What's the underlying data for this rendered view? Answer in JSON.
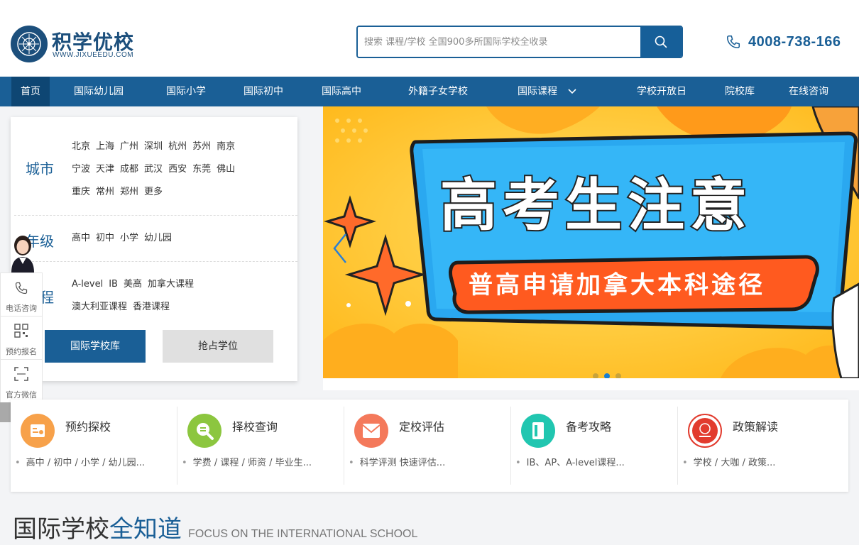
{
  "header": {
    "logo_name": "积学优校",
    "logo_url": "WWW.JIXUEEDU.COM",
    "search_placeholder": "搜索 课程/学校 全国900多所国际学校全收录",
    "phone": "4008-738-166"
  },
  "nav": {
    "items": [
      {
        "label": "首页",
        "active": true
      },
      {
        "label": "国际幼儿园"
      },
      {
        "label": "国际小学"
      },
      {
        "label": "国际初中"
      },
      {
        "label": "国际高中"
      },
      {
        "label": "外籍子女学校"
      },
      {
        "label": "国际课程"
      },
      {
        "label": "学校开放日"
      },
      {
        "label": "院校库"
      },
      {
        "label": "在线咨询"
      }
    ]
  },
  "filter": {
    "city_title": "城市",
    "cities": [
      "北京",
      "上海",
      "广州",
      "深圳",
      "杭州",
      "苏州",
      "南京",
      "宁波",
      "天津",
      "成都",
      "武汉",
      "西安",
      "东莞",
      "佛山",
      "重庆",
      "常州",
      "郑州",
      "更多"
    ],
    "grade_title": "年级",
    "grades": [
      "高中",
      "初中",
      "小学",
      "幼儿园"
    ],
    "course_title": "课程",
    "courses": [
      "A-level",
      "IB",
      "美高",
      "加拿大课程",
      "澳大利亚课程",
      "香港课程"
    ],
    "btn_schools": "国际学校库",
    "btn_seat": "抢占学位"
  },
  "float_bar": {
    "items": [
      {
        "label": "电话咨询",
        "icon": "phone-icon"
      },
      {
        "label": "预约报名",
        "icon": "qrcode-icon"
      },
      {
        "label": "官方微信",
        "icon": "scan-icon"
      }
    ]
  },
  "banner": {
    "title": "高考生注意",
    "subtitle": "普高申请加拿大本科途径"
  },
  "services": [
    {
      "title": "预约探校",
      "desc": "高中 / 初中 / 小学 / 幼儿园...",
      "color": "#f7a14a",
      "icon": "calendar-icon"
    },
    {
      "title": "择校查询",
      "desc": "学费 / 课程 / 师资 / 毕业生...",
      "color": "#8cc63f",
      "icon": "search-icon"
    },
    {
      "title": "定校评估",
      "desc": "科学评测 快速评估...",
      "color": "#f4795b",
      "icon": "offer-icon"
    },
    {
      "title": "备考攻略",
      "desc": "IB、AP、A-level课程...",
      "color": "#21c6b0",
      "icon": "book-icon"
    },
    {
      "title": "政策解读",
      "desc": "学校 / 大咖 / 政策...",
      "color": "#e23b2e",
      "icon": "badge-icon"
    }
  ],
  "section": {
    "title_a": "国际学校",
    "title_b": "全知道",
    "title_en": "FOCUS ON THE INTERNATIONAL SCHOOL"
  }
}
